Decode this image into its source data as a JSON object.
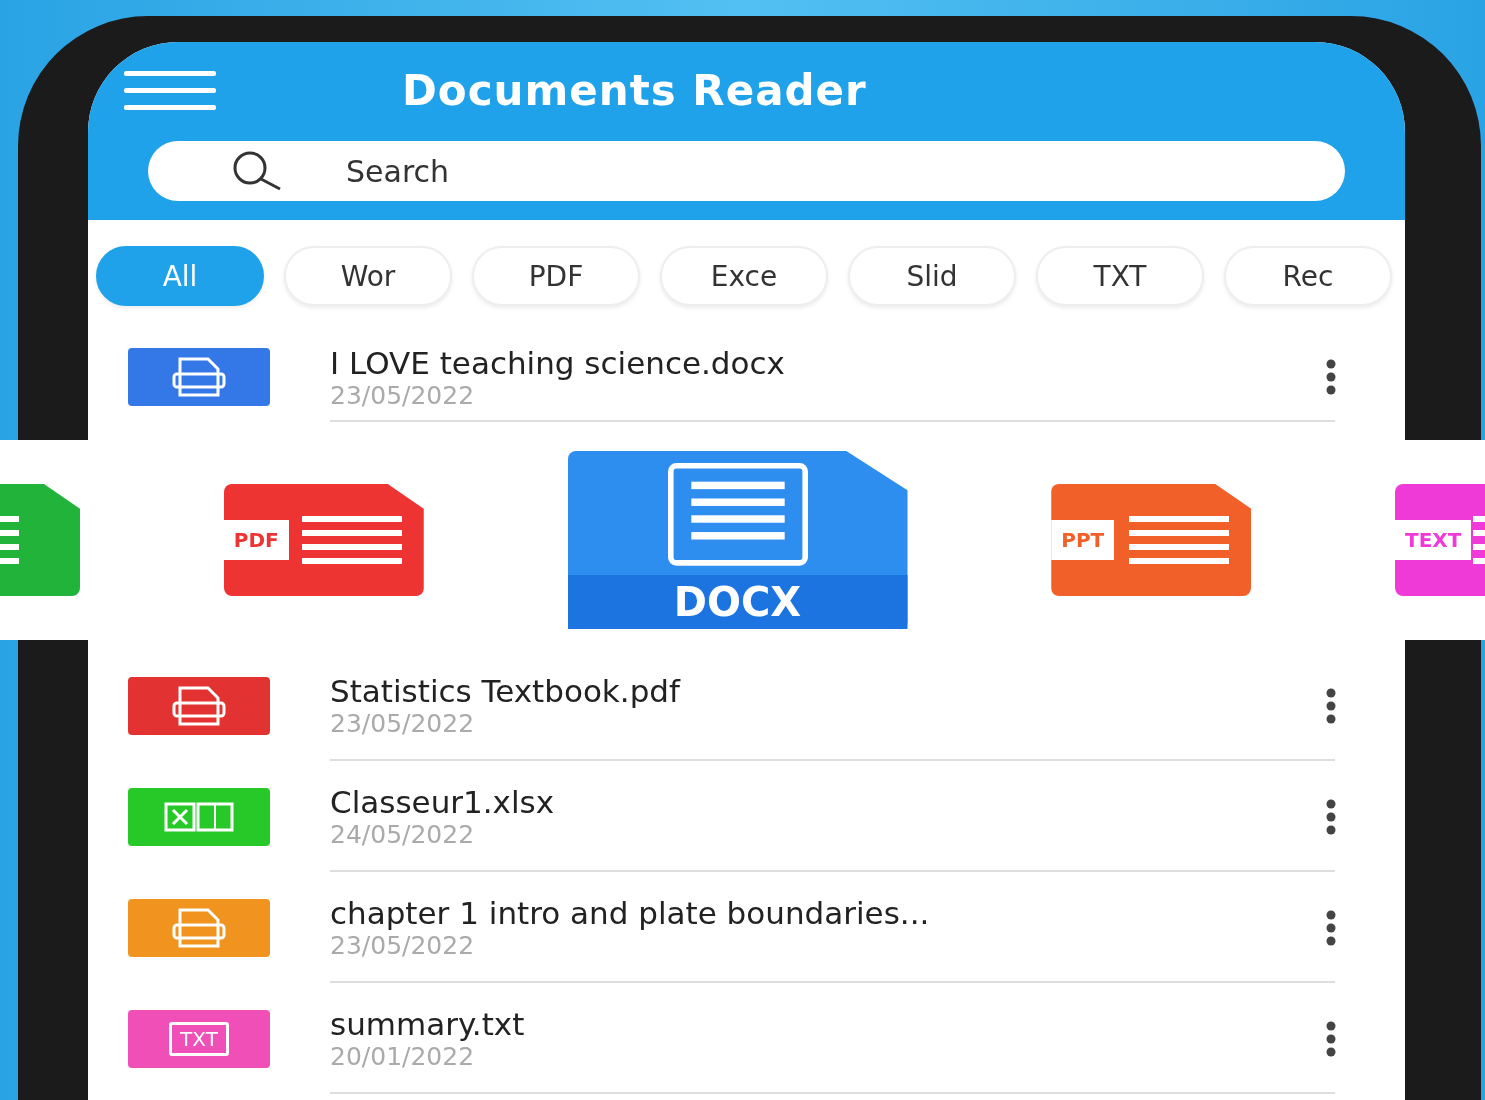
{
  "app_bar": {
    "title": "Documents Reader"
  },
  "search": {
    "placeholder": "Search"
  },
  "filter_chips": [
    {
      "label": "All",
      "selected": true
    },
    {
      "label": "Wor",
      "selected": false
    },
    {
      "label": "PDF",
      "selected": false
    },
    {
      "label": "Exce",
      "selected": false
    },
    {
      "label": "Slid",
      "selected": false
    },
    {
      "label": "TXT",
      "selected": false
    },
    {
      "label": "Rec",
      "selected": false
    }
  ],
  "banner": {
    "file_types": [
      {
        "kind": "sheet",
        "color": "#22b33a"
      },
      {
        "kind": "tag",
        "label": "PDF",
        "color": "#ee3333"
      },
      {
        "kind": "large",
        "label": "DOCX",
        "color": "#2d8ef0"
      },
      {
        "kind": "tag",
        "label": "PPT",
        "color": "#f2602a"
      },
      {
        "kind": "tag",
        "label": "TEXT",
        "color": "#f03ad8"
      }
    ]
  },
  "files": [
    {
      "name": "I LOVE teaching science.docx",
      "date": "23/05/2022",
      "kind": "doc",
      "color": "#3478e8"
    },
    {
      "name": "Statistics Textbook.pdf",
      "date": "23/05/2022",
      "kind": "doc",
      "color": "#e23232"
    },
    {
      "name": "Classeur1.xlsx",
      "date": "24/05/2022",
      "kind": "sheet",
      "color": "#27c928"
    },
    {
      "name": "chapter 1 intro and plate boundaries...",
      "date": "23/05/2022",
      "kind": "doc",
      "color": "#f0931f"
    },
    {
      "name": "summary.txt",
      "date": "20/01/2022",
      "kind": "text",
      "icon_label": "TXT",
      "color": "#f04fb8"
    }
  ]
}
